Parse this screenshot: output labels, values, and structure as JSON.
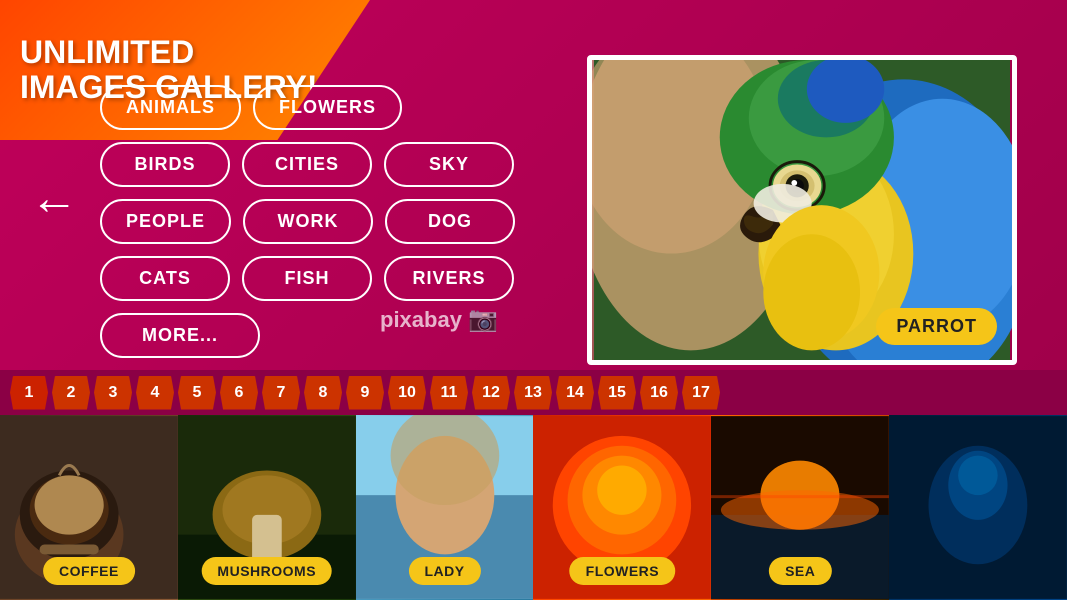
{
  "app": {
    "title": "Unlimited Images Gallery!"
  },
  "banner": {
    "line1": "UNLIMITED",
    "line2": "IMAGES GALLERY!"
  },
  "categories": {
    "row0": [
      {
        "label": "ANIMALS",
        "active": false
      },
      {
        "label": "FLOWERS",
        "active": false
      }
    ],
    "row1": [
      {
        "label": "BIRDS",
        "active": false
      },
      {
        "label": "CITIES",
        "active": false
      },
      {
        "label": "SKY",
        "active": false
      }
    ],
    "row2": [
      {
        "label": "PEOPLE",
        "active": false
      },
      {
        "label": "WORK",
        "active": false
      },
      {
        "label": "DOG",
        "active": false
      }
    ],
    "row3": [
      {
        "label": "CATS",
        "active": false
      },
      {
        "label": "FISH",
        "active": false
      },
      {
        "label": "RIVERS",
        "active": false
      }
    ],
    "more": "MORE..."
  },
  "pixabay": {
    "text": "pixabay"
  },
  "main_image": {
    "label": "PARROT"
  },
  "pagination": {
    "pages": [
      "1",
      "2",
      "3",
      "4",
      "5",
      "6",
      "7",
      "8",
      "9",
      "10",
      "11",
      "12",
      "13",
      "14",
      "15",
      "16",
      "17"
    ],
    "active": "1"
  },
  "thumbnails": [
    {
      "label": "COFFEE",
      "bg_class": "thumb-coffee"
    },
    {
      "label": "MUSHROOMS",
      "bg_class": "thumb-mushrooms"
    },
    {
      "label": "LADY",
      "bg_class": "thumb-lady"
    },
    {
      "label": "FLOWERS",
      "bg_class": "thumb-flowers"
    },
    {
      "label": "SEA",
      "bg_class": "thumb-sea"
    },
    {
      "label": "",
      "bg_class": "thumb-last"
    }
  ]
}
